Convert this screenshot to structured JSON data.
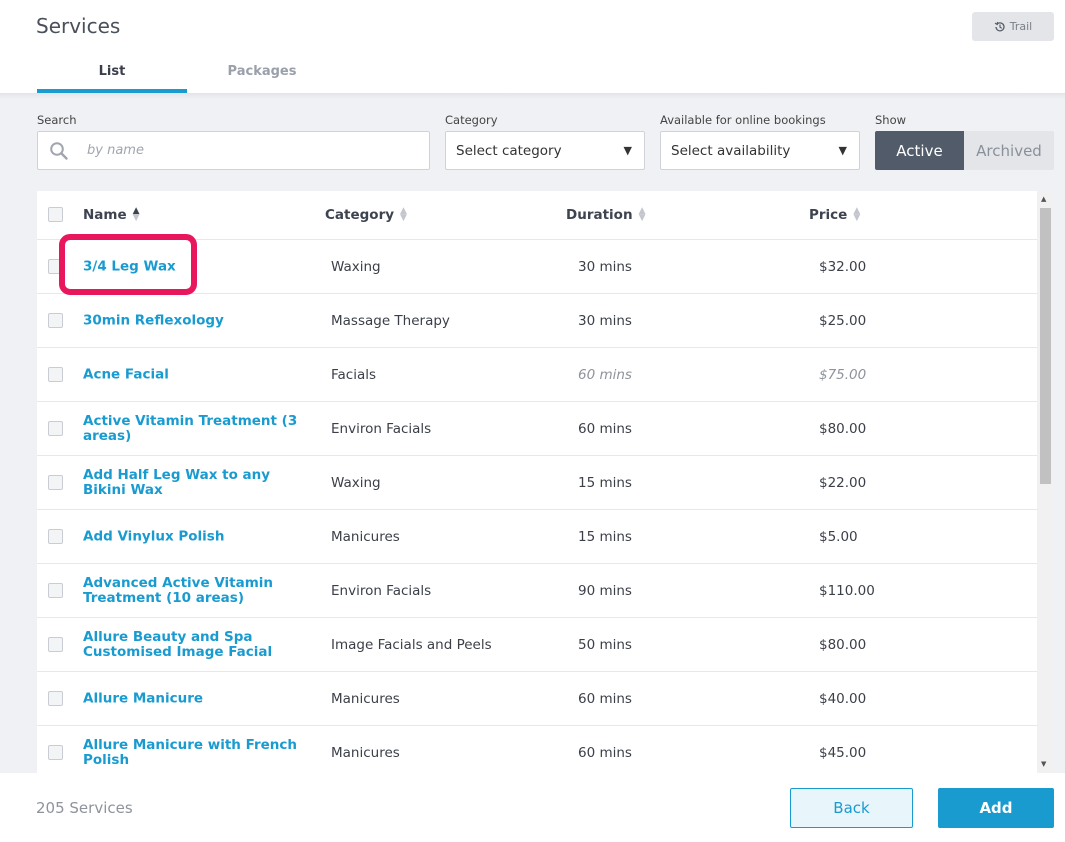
{
  "header": {
    "title": "Services",
    "trail_label": "Trail",
    "tabs": [
      {
        "label": "List"
      },
      {
        "label": "Packages"
      }
    ]
  },
  "filters": {
    "search_label": "Search",
    "search_placeholder": "by name",
    "category_label": "Category",
    "category_value": "Select category",
    "availability_label": "Available for online bookings",
    "availability_value": "Select availability",
    "show_label": "Show",
    "show_options": [
      "Active",
      "Archived"
    ]
  },
  "table": {
    "columns": [
      "Name",
      "Category",
      "Duration",
      "Price"
    ],
    "rows": [
      {
        "name": "3/4 Leg Wax",
        "category": "Waxing",
        "duration": "30 mins",
        "price": "$32.00"
      },
      {
        "name": "30min Reflexology",
        "category": "Massage Therapy",
        "duration": "30 mins",
        "price": "$25.00"
      },
      {
        "name": "Acne Facial",
        "category": "Facials",
        "duration": "60 mins",
        "price": "$75.00"
      },
      {
        "name": "Active Vitamin Treatment (3 areas)",
        "category": "Environ Facials",
        "duration": "60 mins",
        "price": "$80.00"
      },
      {
        "name": "Add Half Leg Wax to any Bikini Wax",
        "category": "Waxing",
        "duration": "15 mins",
        "price": "$22.00"
      },
      {
        "name": "Add Vinylux Polish",
        "category": "Manicures",
        "duration": "15 mins",
        "price": "$5.00"
      },
      {
        "name": "Advanced Active Vitamin Treatment (10 areas)",
        "category": "Environ Facials",
        "duration": "90 mins",
        "price": "$110.00"
      },
      {
        "name": "Allure Beauty and Spa Customised Image Facial",
        "category": "Image Facials and Peels",
        "duration": "50 mins",
        "price": "$80.00"
      },
      {
        "name": "Allure Manicure",
        "category": "Manicures",
        "duration": "60 mins",
        "price": "$40.00"
      },
      {
        "name": "Allure Manicure with French Polish",
        "category": "Manicures",
        "duration": "60 mins",
        "price": "$45.00"
      }
    ]
  },
  "footer": {
    "count": "205 Services",
    "back_label": "Back",
    "add_label": "Add"
  },
  "colors": {
    "accent": "#1a9bd0",
    "highlight": "#e8175d",
    "toggle_active": "#515b6a"
  }
}
